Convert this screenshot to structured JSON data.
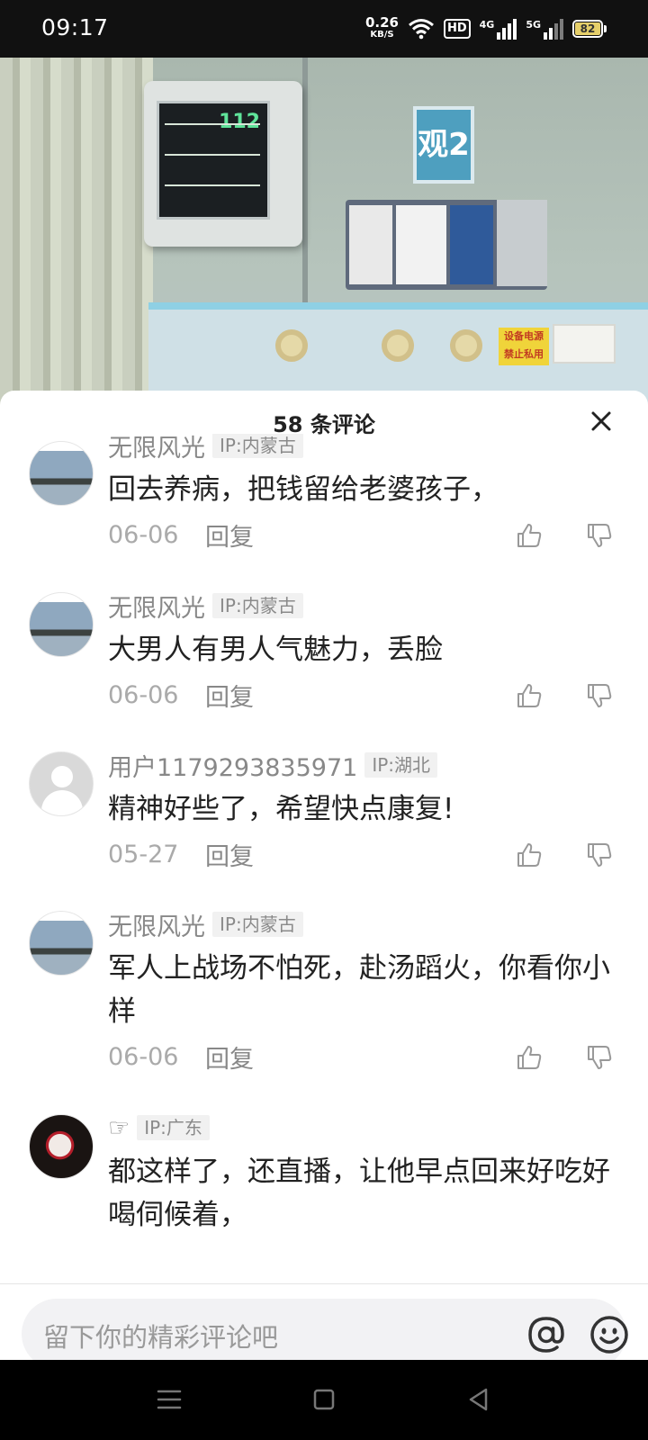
{
  "status_bar": {
    "time": "09:17",
    "net_speed_value": "0.26",
    "net_speed_unit": "KB/S",
    "hd_label": "HD",
    "signal1_label": "4G",
    "signal2_label": "5G",
    "battery_level": "82"
  },
  "video": {
    "monitor_heart_rate": "112",
    "ward_sign": "观2",
    "warning_sign_line1": "设备电源",
    "warning_sign_line2": "禁止私用"
  },
  "comment_sheet": {
    "title": "58 条评论",
    "comments": [
      {
        "name": "无限风光",
        "ip": "IP:内蒙古",
        "text": "回去养病，把钱留给老婆孩子，",
        "date": "06-06",
        "reply": "回复",
        "avatar": "landscape"
      },
      {
        "name": "无限风光",
        "ip": "IP:内蒙古",
        "text": "大男人有男人气魅力，丢脸",
        "date": "06-06",
        "reply": "回复",
        "avatar": "landscape"
      },
      {
        "name": "用户1179293835971",
        "ip": "IP:湖北",
        "text": "精神好些了，希望快点康复!",
        "date": "05-27",
        "reply": "回复",
        "avatar": "default-user"
      },
      {
        "name": "无限风光",
        "ip": "IP:内蒙古",
        "text": "军人上战场不怕死，赴汤蹈火，你看你小样",
        "date": "06-06",
        "reply": "回复",
        "avatar": "landscape"
      },
      {
        "name": "☞",
        "ip": "IP:广东",
        "text": "都这样了，还直播，让他早点回来好吃好喝伺候着，",
        "date": "",
        "reply": "",
        "avatar": "joker"
      }
    ]
  },
  "input": {
    "placeholder": "留下你的精彩评论吧"
  },
  "icons": {
    "like": "thumbs-up-icon",
    "dislike": "thumbs-down-icon",
    "close": "close-icon",
    "mention": "at-icon",
    "emoji": "emoji-icon"
  },
  "colors": {
    "accent_text": "#222222",
    "secondary_text": "#888888",
    "input_bg": "#f2f2f4"
  }
}
